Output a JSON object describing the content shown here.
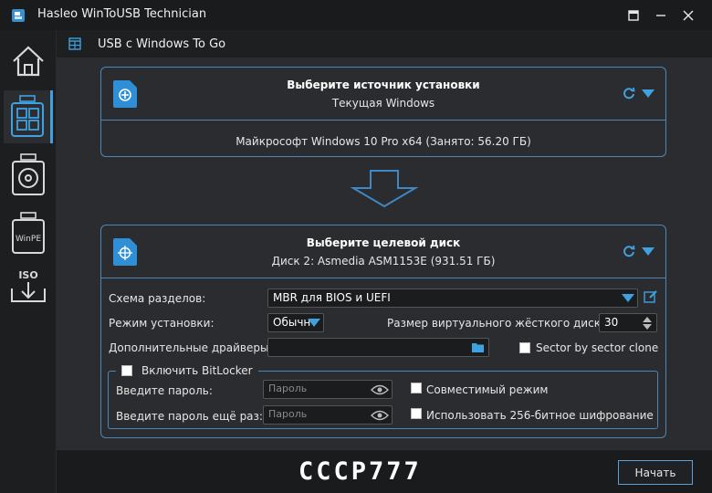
{
  "window": {
    "title": "Hasleo WinToUSB Technician",
    "controls": [
      "pin-icon",
      "minimize-icon",
      "close-icon"
    ]
  },
  "sidebar": {
    "items": [
      {
        "name": "home",
        "icon": "home-icon",
        "label": ""
      },
      {
        "name": "windows-to-go",
        "icon": "windows-tiles-icon",
        "label": "",
        "active": true
      },
      {
        "name": "disk",
        "icon": "disk-icon",
        "label": ""
      },
      {
        "name": "winpe",
        "icon": "winpe-icon",
        "label": "WinPE"
      },
      {
        "name": "iso",
        "icon": "iso-download-icon",
        "label": "ISO"
      }
    ]
  },
  "header": {
    "title": "USB с Windows To Go"
  },
  "source": {
    "title": "Выберите источник установки",
    "subtitle": "Текущая Windows",
    "detail": "Майкрософт Windows 10 Pro x64 (Занято: 56.20 ГБ)"
  },
  "target": {
    "title": "Выберите целевой диск",
    "subtitle": "Диск 2: Asmedia ASM1153E (931.51 ГБ)"
  },
  "options": {
    "partition_label": "Схема разделов:",
    "partition_value": "MBR для BIOS и UEFI",
    "mode_label": "Режим установки:",
    "mode_value": "Обычн",
    "vhd_label": "Размер виртуального жёсткого диска:",
    "vhd_value": "30",
    "drivers_label": "Дополнительные драйверы:",
    "drivers_value": "",
    "sector_label": "Sector by sector clone"
  },
  "bitlocker": {
    "enable_label": "Включить BitLocker",
    "password_label": "Введите пароль:",
    "password_placeholder": "Пароль",
    "confirm_label": "Введите пароль ещё раз:",
    "confirm_placeholder": "Пароль",
    "compat_label": "Совместимый режим",
    "aes256_label": "Использовать 256-битное шифрование"
  },
  "footer": {
    "logo": "CCCP777",
    "start_label": "Начать"
  },
  "colors": {
    "accent": "#3ea1e0",
    "border": "#4f86b3",
    "background": "#2b2c2f",
    "titlebar": "#1a1b1d"
  }
}
